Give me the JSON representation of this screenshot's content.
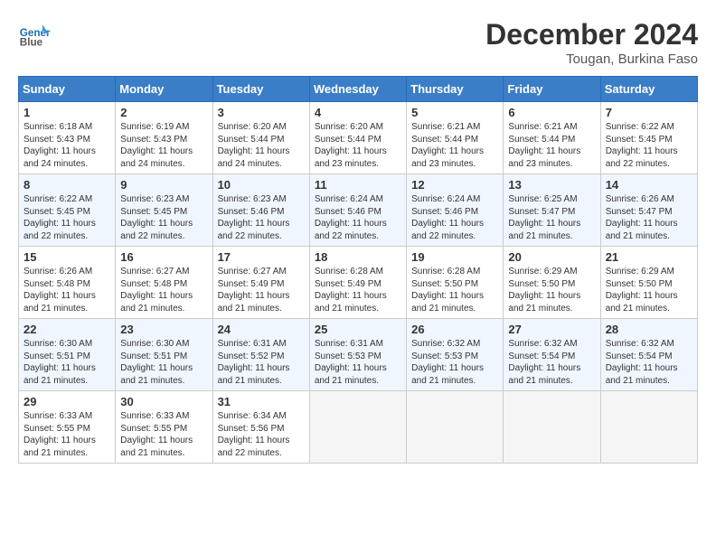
{
  "header": {
    "logo_line1": "General",
    "logo_line2": "Blue",
    "month": "December 2024",
    "location": "Tougan, Burkina Faso"
  },
  "days_of_week": [
    "Sunday",
    "Monday",
    "Tuesday",
    "Wednesday",
    "Thursday",
    "Friday",
    "Saturday"
  ],
  "weeks": [
    [
      {
        "num": "1",
        "sunrise": "6:18 AM",
        "sunset": "5:43 PM",
        "daylight": "11 hours and 24 minutes."
      },
      {
        "num": "2",
        "sunrise": "6:19 AM",
        "sunset": "5:43 PM",
        "daylight": "11 hours and 24 minutes."
      },
      {
        "num": "3",
        "sunrise": "6:20 AM",
        "sunset": "5:44 PM",
        "daylight": "11 hours and 24 minutes."
      },
      {
        "num": "4",
        "sunrise": "6:20 AM",
        "sunset": "5:44 PM",
        "daylight": "11 hours and 23 minutes."
      },
      {
        "num": "5",
        "sunrise": "6:21 AM",
        "sunset": "5:44 PM",
        "daylight": "11 hours and 23 minutes."
      },
      {
        "num": "6",
        "sunrise": "6:21 AM",
        "sunset": "5:44 PM",
        "daylight": "11 hours and 23 minutes."
      },
      {
        "num": "7",
        "sunrise": "6:22 AM",
        "sunset": "5:45 PM",
        "daylight": "11 hours and 22 minutes."
      }
    ],
    [
      {
        "num": "8",
        "sunrise": "6:22 AM",
        "sunset": "5:45 PM",
        "daylight": "11 hours and 22 minutes."
      },
      {
        "num": "9",
        "sunrise": "6:23 AM",
        "sunset": "5:45 PM",
        "daylight": "11 hours and 22 minutes."
      },
      {
        "num": "10",
        "sunrise": "6:23 AM",
        "sunset": "5:46 PM",
        "daylight": "11 hours and 22 minutes."
      },
      {
        "num": "11",
        "sunrise": "6:24 AM",
        "sunset": "5:46 PM",
        "daylight": "11 hours and 22 minutes."
      },
      {
        "num": "12",
        "sunrise": "6:24 AM",
        "sunset": "5:46 PM",
        "daylight": "11 hours and 22 minutes."
      },
      {
        "num": "13",
        "sunrise": "6:25 AM",
        "sunset": "5:47 PM",
        "daylight": "11 hours and 21 minutes."
      },
      {
        "num": "14",
        "sunrise": "6:26 AM",
        "sunset": "5:47 PM",
        "daylight": "11 hours and 21 minutes."
      }
    ],
    [
      {
        "num": "15",
        "sunrise": "6:26 AM",
        "sunset": "5:48 PM",
        "daylight": "11 hours and 21 minutes."
      },
      {
        "num": "16",
        "sunrise": "6:27 AM",
        "sunset": "5:48 PM",
        "daylight": "11 hours and 21 minutes."
      },
      {
        "num": "17",
        "sunrise": "6:27 AM",
        "sunset": "5:49 PM",
        "daylight": "11 hours and 21 minutes."
      },
      {
        "num": "18",
        "sunrise": "6:28 AM",
        "sunset": "5:49 PM",
        "daylight": "11 hours and 21 minutes."
      },
      {
        "num": "19",
        "sunrise": "6:28 AM",
        "sunset": "5:50 PM",
        "daylight": "11 hours and 21 minutes."
      },
      {
        "num": "20",
        "sunrise": "6:29 AM",
        "sunset": "5:50 PM",
        "daylight": "11 hours and 21 minutes."
      },
      {
        "num": "21",
        "sunrise": "6:29 AM",
        "sunset": "5:50 PM",
        "daylight": "11 hours and 21 minutes."
      }
    ],
    [
      {
        "num": "22",
        "sunrise": "6:30 AM",
        "sunset": "5:51 PM",
        "daylight": "11 hours and 21 minutes."
      },
      {
        "num": "23",
        "sunrise": "6:30 AM",
        "sunset": "5:51 PM",
        "daylight": "11 hours and 21 minutes."
      },
      {
        "num": "24",
        "sunrise": "6:31 AM",
        "sunset": "5:52 PM",
        "daylight": "11 hours and 21 minutes."
      },
      {
        "num": "25",
        "sunrise": "6:31 AM",
        "sunset": "5:53 PM",
        "daylight": "11 hours and 21 minutes."
      },
      {
        "num": "26",
        "sunrise": "6:32 AM",
        "sunset": "5:53 PM",
        "daylight": "11 hours and 21 minutes."
      },
      {
        "num": "27",
        "sunrise": "6:32 AM",
        "sunset": "5:54 PM",
        "daylight": "11 hours and 21 minutes."
      },
      {
        "num": "28",
        "sunrise": "6:32 AM",
        "sunset": "5:54 PM",
        "daylight": "11 hours and 21 minutes."
      }
    ],
    [
      {
        "num": "29",
        "sunrise": "6:33 AM",
        "sunset": "5:55 PM",
        "daylight": "11 hours and 21 minutes."
      },
      {
        "num": "30",
        "sunrise": "6:33 AM",
        "sunset": "5:55 PM",
        "daylight": "11 hours and 21 minutes."
      },
      {
        "num": "31",
        "sunrise": "6:34 AM",
        "sunset": "5:56 PM",
        "daylight": "11 hours and 22 minutes."
      },
      null,
      null,
      null,
      null
    ]
  ]
}
